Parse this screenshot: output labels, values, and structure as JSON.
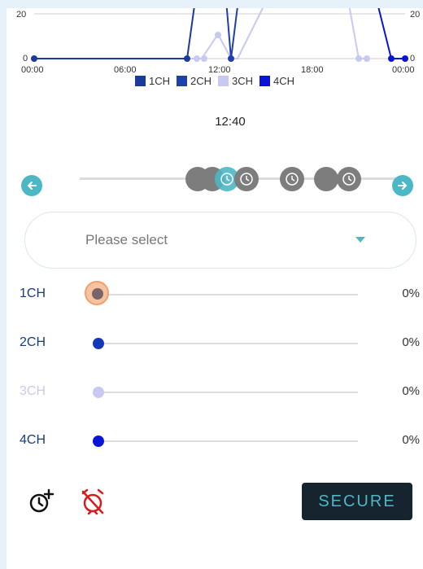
{
  "chart_data": {
    "type": "line",
    "x_ticks": [
      "00:00",
      "06:00",
      "12:00",
      "18:00",
      "00:00"
    ],
    "y_ticks_left": [
      "20",
      "0"
    ],
    "y_ticks_right": [
      "20",
      "0"
    ],
    "series": [
      {
        "name": "1CH",
        "color": "#1a3a9c"
      },
      {
        "name": "2CH",
        "color": "#1e40af"
      },
      {
        "name": "3CH",
        "color": "#c7c9f0"
      },
      {
        "name": "4CH",
        "color": "#0a14d8"
      }
    ]
  },
  "time_display": "12:40",
  "select": {
    "placeholder": "Please select"
  },
  "channels": [
    {
      "label": "1CH",
      "value": "0%",
      "label_color": "#1a3a7a",
      "thumb_color": "#7a6468"
    },
    {
      "label": "2CH",
      "value": "0%",
      "label_color": "#1a3a7a",
      "thumb_color": "#1337b8"
    },
    {
      "label": "3CH",
      "value": "0%",
      "label_color": "#c9cbe6",
      "thumb_color": "#c7c9f0"
    },
    {
      "label": "4CH",
      "value": "0%",
      "label_color": "#1a3a7a",
      "thumb_color": "#0a14d8"
    }
  ],
  "buttons": {
    "secure": "SECURE"
  },
  "icons": {
    "prev": "arrow-left-icon",
    "next": "arrow-right-icon",
    "add_timer": "clock-plus-icon",
    "alarm_off": "alarm-off-icon",
    "marker": "clock-icon"
  },
  "colors": {
    "accent": "#4db8c5",
    "button_bg": "#15242e",
    "alarm_off": "#d81b1b"
  }
}
